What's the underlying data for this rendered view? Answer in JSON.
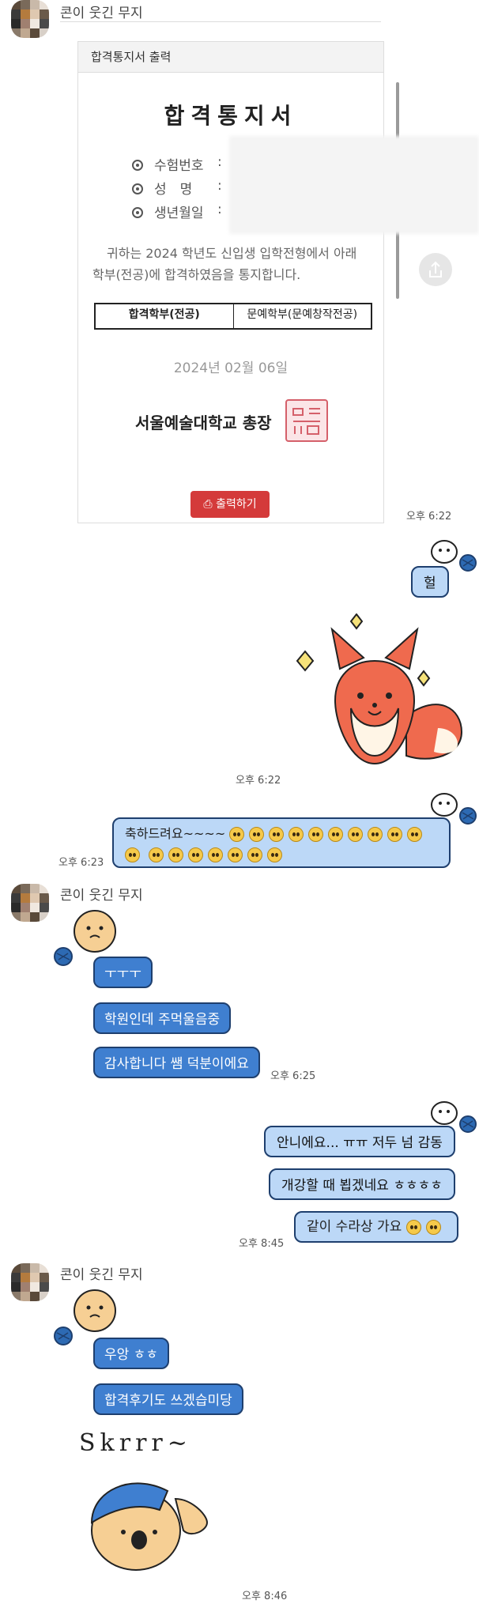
{
  "chat": {
    "contact_name": "콘이 웃긴 무지",
    "messages": {
      "t1": "오후 6:22",
      "t2": "오후 6:22",
      "t3": "오후 6:23",
      "t4": "오후 6:25",
      "t5": "오후 8:45",
      "t6": "오후 8:46",
      "heol": "헐",
      "congrats_text": "축하드려요~~~~",
      "ttt": "ㅜㅜㅜ",
      "academy": "학원인데 주먹울음중",
      "thanks": "감사합니다 쌤 덕분이에요",
      "no": "안니에요... ㅠㅠ 저두 넘 감동",
      "opening": "개강할 때 뵙겠네요 ㅎㅎㅎㅎ",
      "together": "같이 수라상 가요",
      "wooang": "우앙 ㅎㅎ",
      "review": "합격후기도 쓰겠습미당"
    },
    "sticker_text": "Skrrr~"
  },
  "certificate": {
    "header": "합격통지서 출력",
    "title": "합격통지서",
    "fields": [
      "수험번호",
      "성　명",
      "생년월일"
    ],
    "notice": "귀하는 2024 학년도 신입생 입학전형에서 아래 학부(전공)에 합격하였음을 통지합니다.",
    "dept_label": "합격학부(전공)",
    "dept_value": "문예학부(문예창작전공)",
    "date": "2024년 02월 06일",
    "president": "서울예술대학교 총장",
    "print_button": "출력하기"
  },
  "colors": {
    "in_bubble": "#3f7fd0",
    "out_bubble": "#bcd8f7",
    "print": "#d43a3a"
  }
}
